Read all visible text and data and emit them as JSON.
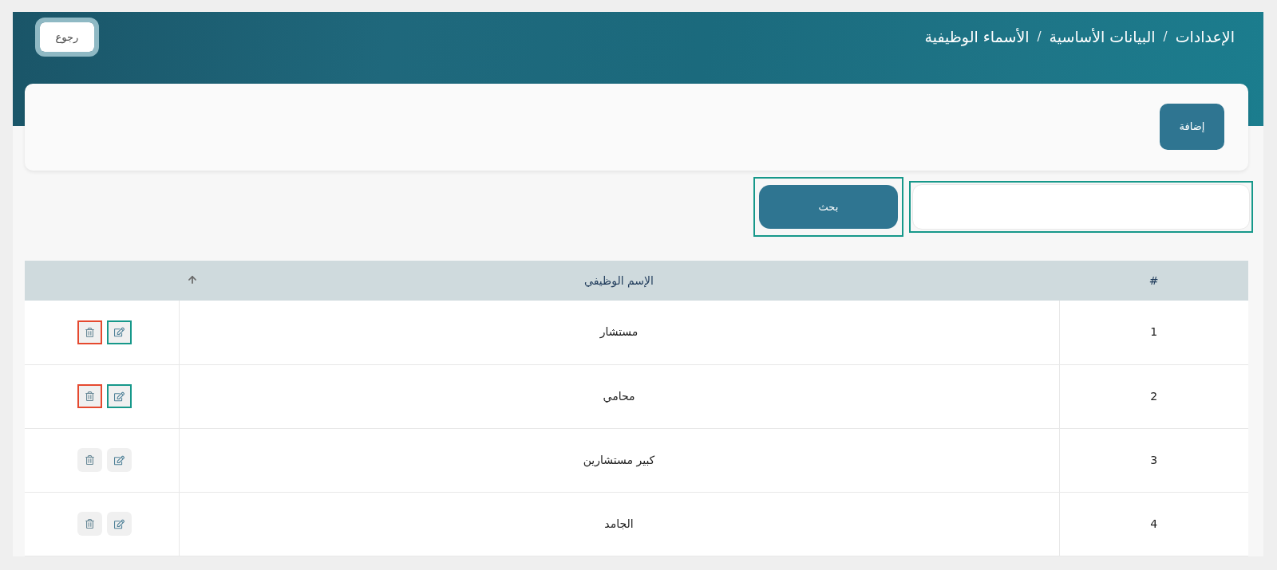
{
  "header": {
    "breadcrumb": [
      {
        "label": "الإعدادات",
        "separator": "/"
      },
      {
        "label": "البيانات الأساسية",
        "separator": "/"
      },
      {
        "label": "الأسماء الوظيفية"
      }
    ],
    "back_button": "رجوع"
  },
  "toolbar": {
    "add_button": "إضافة"
  },
  "search": {
    "field": {
      "highlighted": true
    },
    "button": {
      "label": "بحث",
      "highlighted": true
    }
  },
  "table": {
    "columns": [
      {
        "label": "#",
        "sorted": false
      },
      {
        "label": "الإسم الوظيفي",
        "sorted": true
      }
    ],
    "rows": [
      {
        "number": "1",
        "title": "مستشار",
        "highlighted": true
      },
      {
        "number": "2",
        "title": "محامي",
        "highlighted": true
      },
      {
        "number": "3",
        "title": "كبير مستشارين",
        "highlighted": false
      },
      {
        "number": "4",
        "title": "الجامد",
        "highlighted": false
      }
    ]
  }
}
